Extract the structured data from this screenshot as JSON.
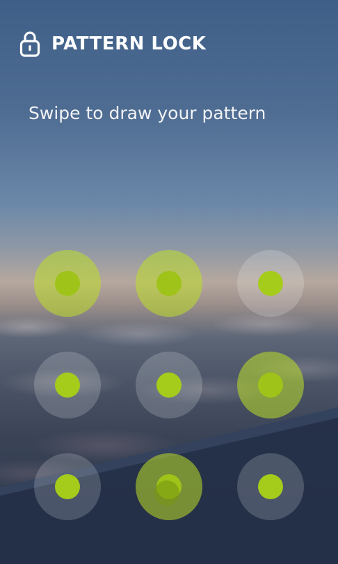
{
  "header": {
    "title": "PATTERN LOCK",
    "icon": "lock-icon"
  },
  "instruction": "Swipe to draw your pattern",
  "colors": {
    "active_ring": "#c0dc2a",
    "dot": "#a5cb1b",
    "text": "#ffffff"
  },
  "grid": {
    "nodes": [
      {
        "row": 1,
        "col": 1,
        "active": true
      },
      {
        "row": 1,
        "col": 2,
        "active": true
      },
      {
        "row": 1,
        "col": 3,
        "active": false
      },
      {
        "row": 2,
        "col": 1,
        "active": false
      },
      {
        "row": 2,
        "col": 2,
        "active": false
      },
      {
        "row": 2,
        "col": 3,
        "active": true
      },
      {
        "row": 3,
        "col": 1,
        "active": false
      },
      {
        "row": 3,
        "col": 2,
        "active": true
      },
      {
        "row": 3,
        "col": 3,
        "active": false
      }
    ]
  }
}
